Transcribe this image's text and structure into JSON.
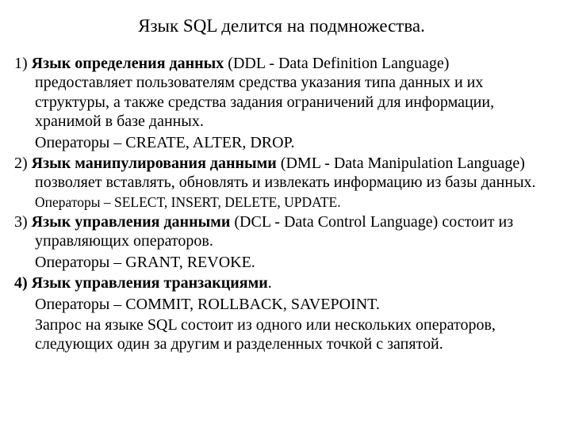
{
  "title": "Язык SQL делится на подмножества.",
  "items": [
    {
      "num": "1) ",
      "bold": "Язык определения данных",
      "rest": " (DDL - Data Definition Language) предоставляет пользователям средства указания типа данных и их структуры, а также средства задания ограничений для информации, хранимой в базе данных.",
      "ops": "Операторы – CREATE, ALTER, DROP.",
      "ops_small": false
    },
    {
      "num": "2) ",
      "bold": "Язык манипулирования данными",
      "rest": " (DML - Data Manipulation Language) позволяет вставлять, обновлять и извлекать информацию из базы данных.",
      "ops": "Операторы – SELECT, INSERT, DELETE, UPDATE.",
      "ops_small": true
    },
    {
      "num": "3) ",
      "bold": "Язык управления данными",
      "rest": " (DCL - Data Control Language) состоит из управляющих операторов.",
      "ops": "Операторы – GRANT, REVOKE.",
      "ops_small": false
    },
    {
      "num_bold": "4) ",
      "bold": "Язык управления транзакциями",
      "bold_dot": ".",
      "rest": "",
      "ops": "Операторы – COMMIT, ROLLBACK, SAVEPOINT.",
      "ops_small": false
    }
  ],
  "footer": "Запрос на языке SQL состоит из одного или нескольких операторов, следующих один за другим и разделенных точкой с запятой."
}
